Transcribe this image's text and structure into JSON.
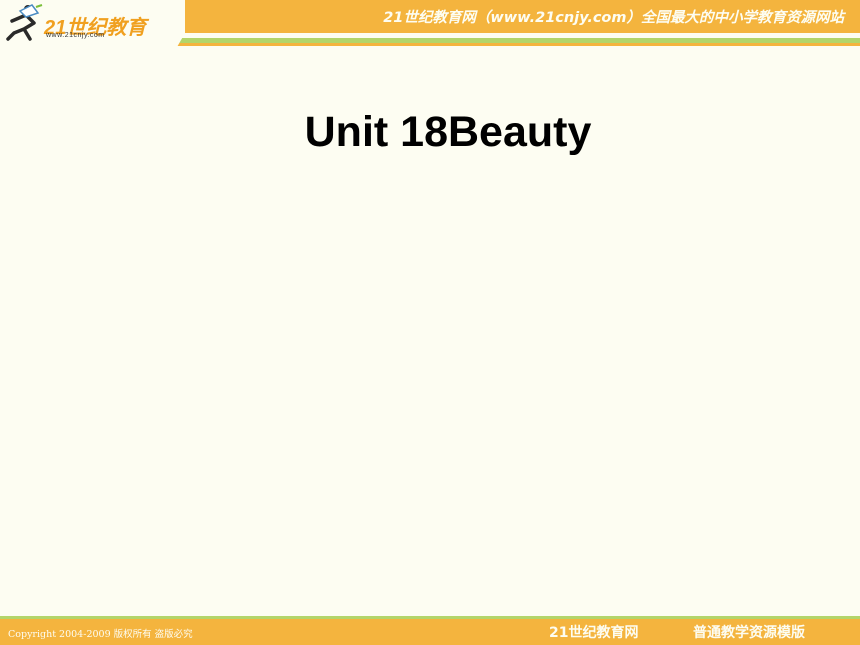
{
  "header": {
    "logo_text": "21世纪教育",
    "logo_url": "www.21cnjy.com",
    "tagline": "21世纪教育网（www.21cnjy.com）全国最大的中小学教育资源网站"
  },
  "slide": {
    "title": "Unit 18Beauty"
  },
  "footer": {
    "copyright": "Copyright 2004-2009 版权所有 盗版必究",
    "site": "21世纪教育网",
    "template": "普通教学资源模版"
  },
  "colors": {
    "accent": "#f4b43e",
    "band": "#b3d56a",
    "background": "#fdfdf2"
  }
}
